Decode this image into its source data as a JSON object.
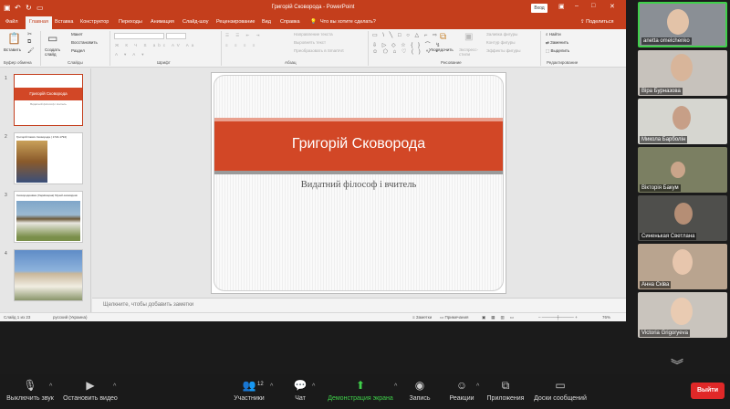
{
  "ppt": {
    "window_title": "Григорій Сковорода  -  PowerPoint",
    "signin": "Вход",
    "tabs": [
      "Файл",
      "Главная",
      "Вставка",
      "Конструктор",
      "Переходы",
      "Анимация",
      "Слайд-шоу",
      "Рецензирование",
      "Вид",
      "Справка"
    ],
    "tell_me": "Что вы хотите сделать?",
    "share": "Поделиться",
    "ribbon": {
      "paste": "Вставить",
      "new_slide": "Создать слайд",
      "layout": "Макет",
      "reset": "Восстановить",
      "section": "Раздел",
      "text_direction": "Направление текста",
      "align_text": "Выровнять текст",
      "convert_smartart": "Преобразовать в SmartArt",
      "arrange": "Упорядочить",
      "quick_styles": "Экспресс-стили",
      "shape_fill": "Заливка фигуры",
      "shape_outline": "Контур фигуры",
      "shape_effects": "Эффекты фигуры",
      "find": "Найти",
      "replace": "Заменить",
      "select": "Выделить",
      "groups": [
        "Буфер обмена",
        "Слайды",
        "Шрифт",
        "Абзац",
        "Рисование",
        "Редактирование"
      ]
    },
    "thumbnails": [
      {
        "num": "1",
        "title": "Григорій Сковорода",
        "sub": "Видатний філософ і вчитель"
      },
      {
        "num": "2",
        "title": "Григорій Савич Сковорода ( 1722-1794)"
      },
      {
        "num": "3",
        "title": "Сковородинівка (Харківщина) Музей-заповідник"
      },
      {
        "num": "4"
      }
    ],
    "slide": {
      "title": "Григорій Сковорода",
      "subtitle": "Видатний філософ і вчитель"
    },
    "notes_placeholder": "Щелкните, чтобы добавить заметки",
    "status": {
      "slide_of": "Слайд 1 из 23",
      "language": "русский (Украина)",
      "notes": "Заметки",
      "comments": "Примечания",
      "zoom": "76%"
    }
  },
  "participants": [
    {
      "name": "anetta omelchenko",
      "speaking": true,
      "bg": "#8a8f95"
    },
    {
      "name": "Віра Бурназова",
      "speaking": false,
      "bg": "#c7c2bc"
    },
    {
      "name": "Микола Барболін",
      "speaking": false,
      "bg": "#d6d6d0"
    },
    {
      "name": "Вікторія Бакум",
      "speaking": false,
      "bg": "#7b7f62"
    },
    {
      "name": "Синенькая Светлана",
      "speaking": false,
      "bg": "#4f4f4c"
    },
    {
      "name": "Анна Сківа",
      "speaking": false,
      "bg": "#b9a48f"
    },
    {
      "name": "Victoria Grigoryeva",
      "speaking": false,
      "bg": "#c9c4bd"
    }
  ],
  "toolbar": {
    "mute": "Выключить звук",
    "stop_video": "Остановить видео",
    "participants": "Участники",
    "participants_count": "12",
    "chat": "Чат",
    "share_screen": "Демонстрация экрана",
    "record": "Запись",
    "reactions": "Реакции",
    "apps": "Приложения",
    "whiteboard": "Доски сообщений",
    "leave": "Выйти"
  },
  "colors": {
    "ppt_accent": "#c43e1c",
    "slide_band": "#d24726",
    "share_green": "#3fd04a",
    "leave_red": "#e02828"
  }
}
